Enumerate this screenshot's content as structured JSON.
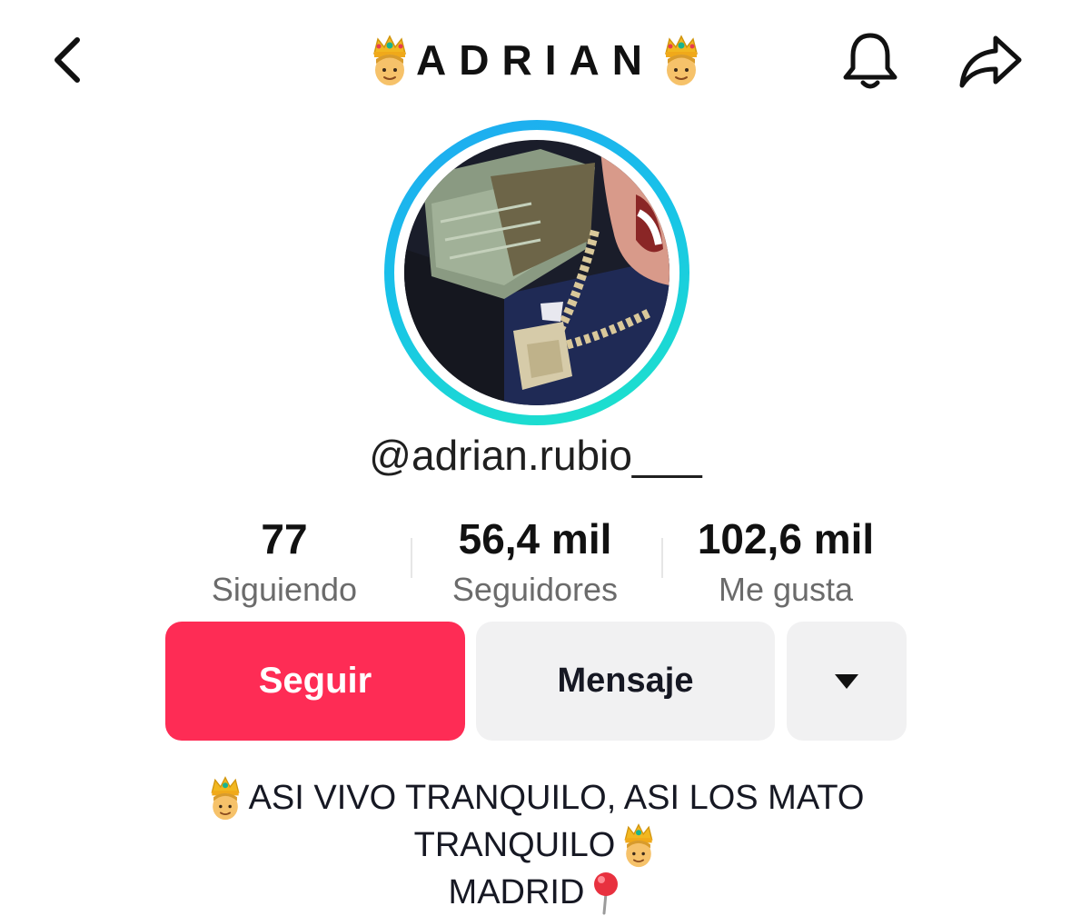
{
  "header": {
    "title": "ADRIAN",
    "back_icon": "chevron-left-icon",
    "bell_icon": "bell-icon",
    "share_icon": "share-arrow-icon"
  },
  "profile": {
    "username": "@adrian.rubio___",
    "avatar_ring_colors": [
      "#1fa8f2",
      "#1de5c8"
    ]
  },
  "stats": [
    {
      "value": "77",
      "label": "Siguiendo"
    },
    {
      "value": "56,4 mil",
      "label": "Seguidores"
    },
    {
      "value": "102,6 mil",
      "label": "Me gusta"
    }
  ],
  "actions": {
    "follow_label": "Seguir",
    "message_label": "Mensaje",
    "more_icon": "caret-down-icon",
    "follow_color": "#fe2c55"
  },
  "bio": {
    "line1": "ASI VIVO TRANQUILO, ASI LOS MATO",
    "line2": "TRANQUILO",
    "line3": "MADRID"
  }
}
